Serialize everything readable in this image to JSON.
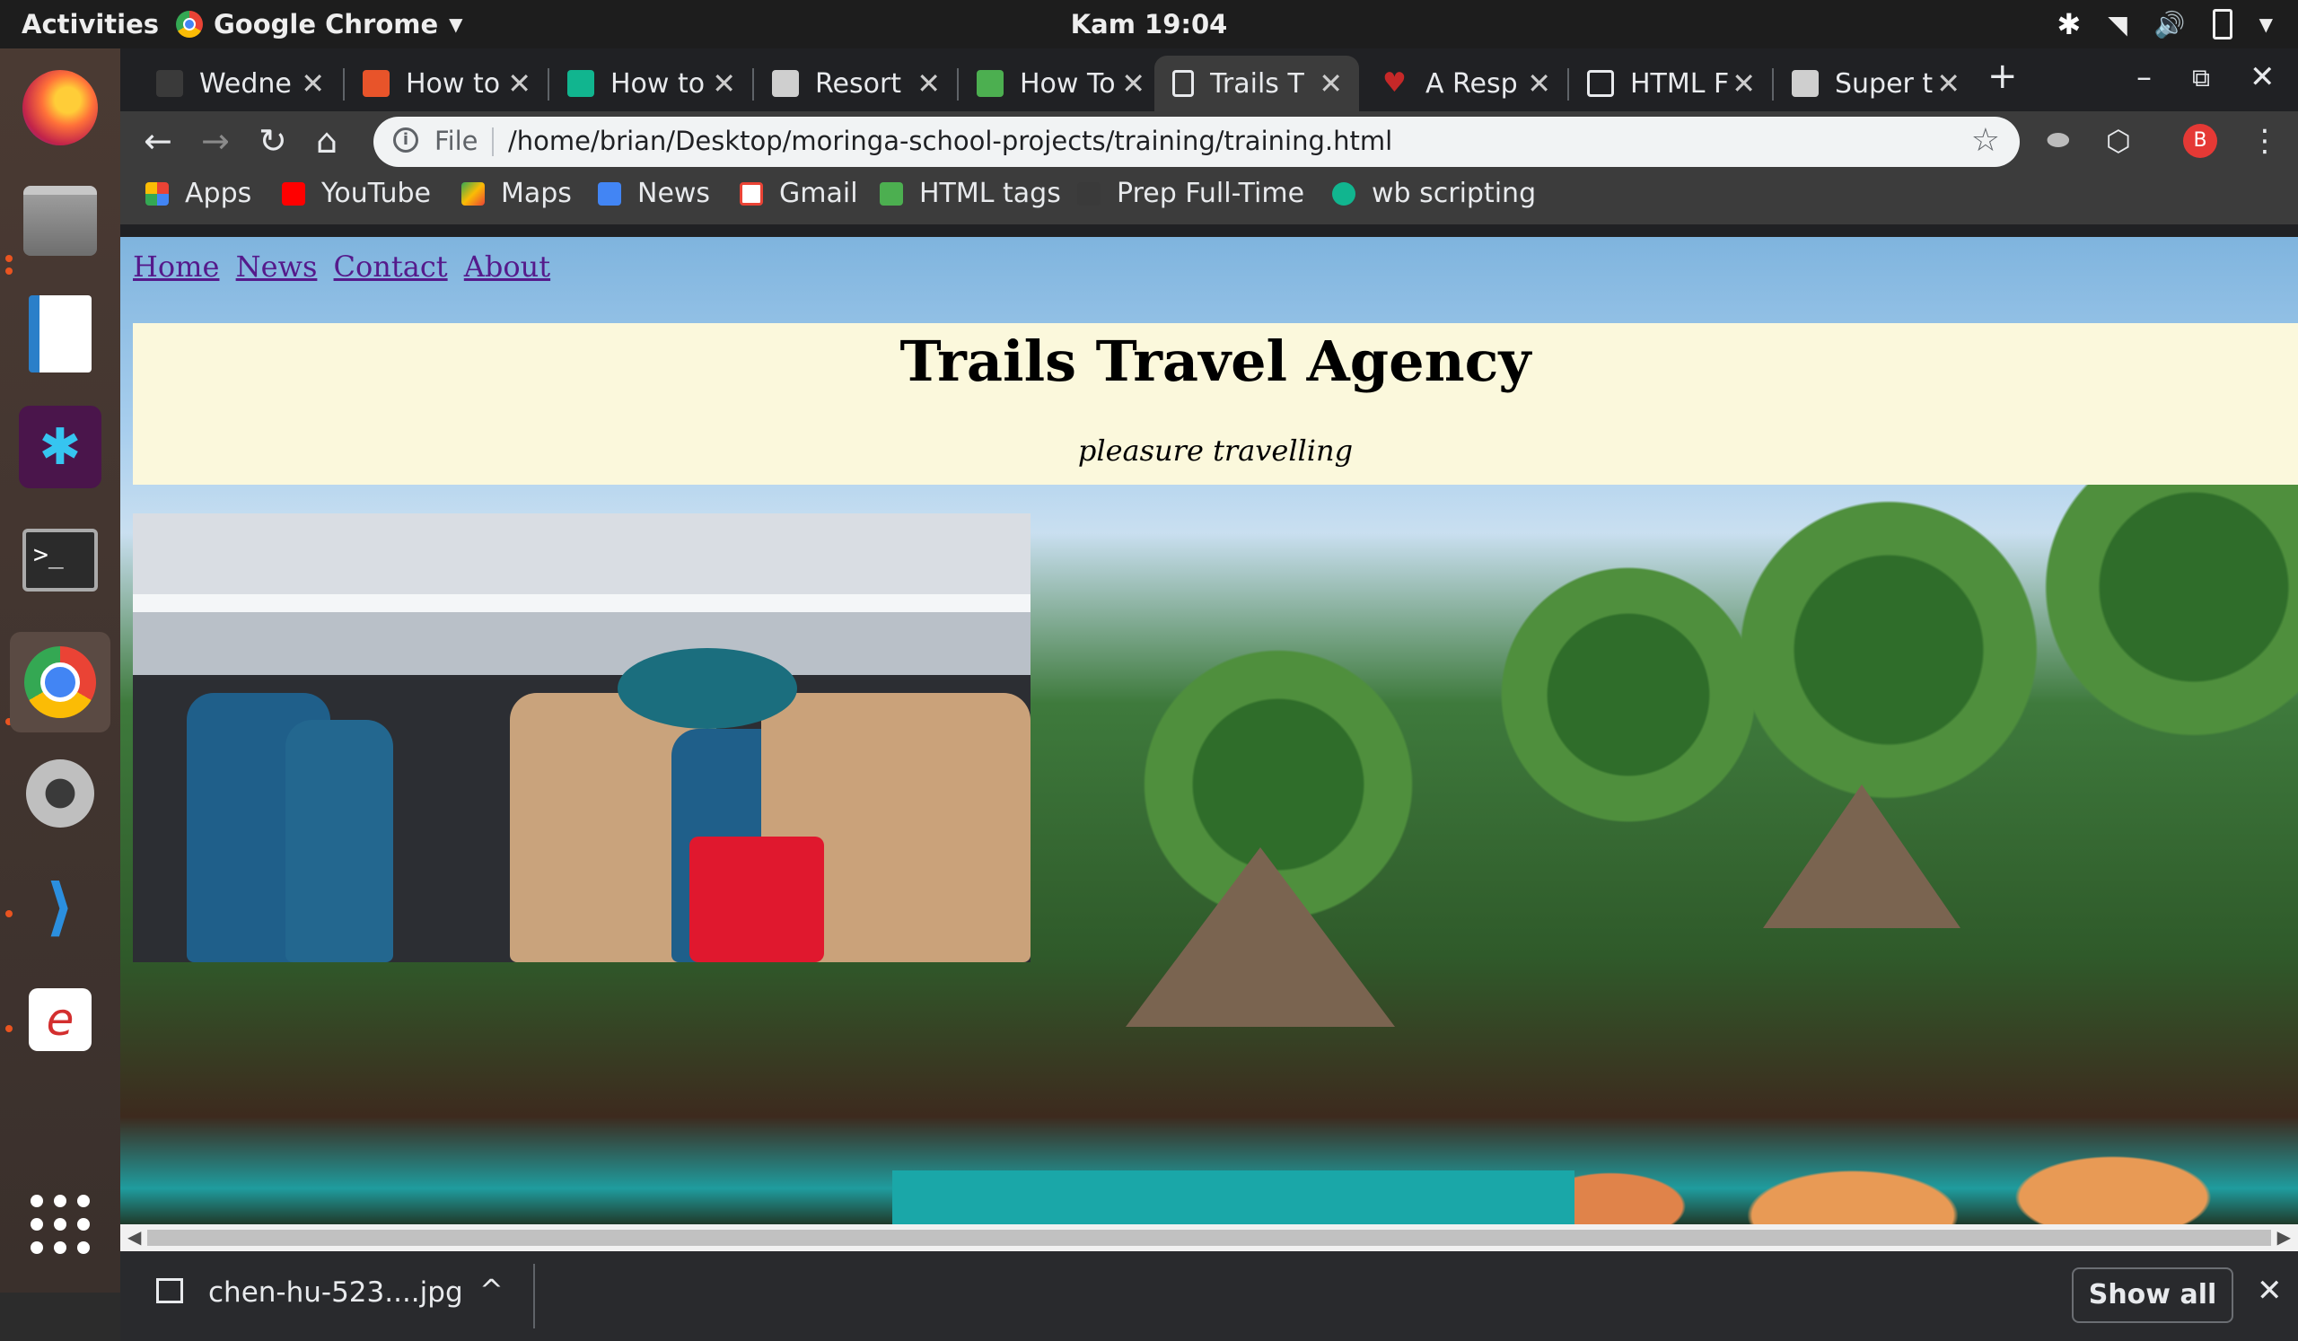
{
  "topbar": {
    "activities": "Activities",
    "app_name": "Google Chrome",
    "clock": "Kam 19:04"
  },
  "dock": {
    "items": [
      "firefox-icon",
      "files-icon",
      "writer-icon",
      "slack-icon",
      "terminal-icon",
      "chrome-icon",
      "settings-icon",
      "vscode-icon",
      "editor-icon"
    ],
    "show_apps": "apps-grid-icon"
  },
  "tabs": [
    {
      "title": "Wedne",
      "fav_color": "#3a3a3a"
    },
    {
      "title": "How to",
      "fav_color": "#e8542a"
    },
    {
      "title": "How to",
      "fav_color": "#11b58f"
    },
    {
      "title": "Resort",
      "fav_color": "#cfcfcf"
    },
    {
      "title": "How To",
      "fav_color": "#4caf50"
    },
    {
      "title": "Trails T",
      "fav_color": "#e8eaed"
    },
    {
      "title": "A Resp",
      "fav_color": "#c62828"
    },
    {
      "title": "HTML F",
      "fav_color": "#e8eaed"
    },
    {
      "title": "Super t",
      "fav_color": "#cfcfcf"
    }
  ],
  "active_tab_index": 5,
  "toolbar": {
    "scheme_label": "File",
    "url": "/home/brian/Desktop/moringa-school-projects/training/training.html",
    "profile_initial": "B"
  },
  "bookmarks": [
    {
      "label": "Apps",
      "color": "#4285f4"
    },
    {
      "label": "YouTube",
      "color": "#ff0000"
    },
    {
      "label": "Maps",
      "color": "#34a853"
    },
    {
      "label": "News",
      "color": "#4285f4"
    },
    {
      "label": "Gmail",
      "color": "#ea4335"
    },
    {
      "label": "HTML tags",
      "color": "#4caf50"
    },
    {
      "label": "Prep Full-Time",
      "color": "#3a3a3a"
    },
    {
      "label": "wb scripting",
      "color": "#11b58f"
    }
  ],
  "page": {
    "nav": [
      "Home",
      "News",
      "Contact",
      "About"
    ],
    "title": "Trails Travel Agency",
    "tagline": "pleasure travelling"
  },
  "downloads": {
    "filename": "chen-hu-523....jpg",
    "show_all": "Show all"
  }
}
